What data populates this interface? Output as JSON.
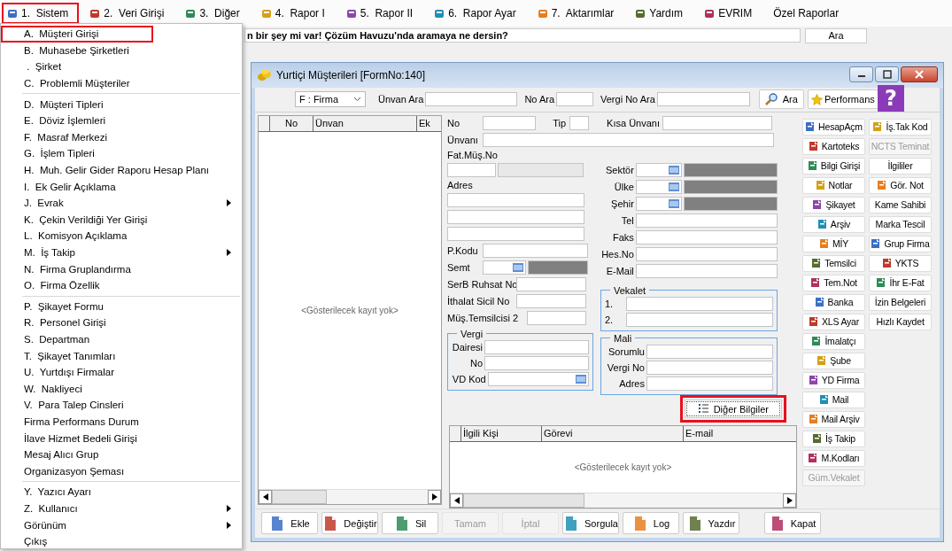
{
  "menu_bar": [
    {
      "label": "1.  Sistem",
      "icon": true,
      "highlighted": true
    },
    {
      "label": "2.  Veri Girişi",
      "icon": true,
      "highlighted": false
    },
    {
      "label": "3.  Diğer",
      "icon": true,
      "highlighted": false
    },
    {
      "label": "4.  Rapor I",
      "icon": true,
      "highlighted": false
    },
    {
      "label": "5.  Rapor II",
      "icon": true,
      "highlighted": false
    },
    {
      "label": "6.  Rapor Ayar",
      "icon": true,
      "highlighted": false
    },
    {
      "label": "7.  Aktarımlar",
      "icon": true,
      "highlighted": false
    },
    {
      "label": "Yardım",
      "icon": true,
      "highlighted": false
    },
    {
      "label": "EVRIM",
      "icon": true,
      "highlighted": false
    },
    {
      "label": "Özel Raporlar",
      "icon": false,
      "highlighted": false
    }
  ],
  "search_bar": {
    "value": "n bir şey mi var! Çözüm Havuzu'nda aramaya ne dersin?",
    "button": "Ara"
  },
  "dropdown": [
    {
      "kind": "item",
      "label": "A.  Müşteri Girişi",
      "highlighted": true,
      "submenu": false
    },
    {
      "kind": "item",
      "label": "B.  Muhasebe Şirketleri",
      "highlighted": false,
      "submenu": false
    },
    {
      "kind": "item",
      "label": " .  Şirket",
      "highlighted": false,
      "submenu": false
    },
    {
      "kind": "item",
      "label": "C.  Problemli Müşteriler",
      "highlighted": false,
      "submenu": false
    },
    {
      "kind": "separator"
    },
    {
      "kind": "item",
      "label": "D.  Müşteri Tipleri",
      "highlighted": false,
      "submenu": false
    },
    {
      "kind": "item",
      "label": "E.  Döviz İşlemleri",
      "highlighted": false,
      "submenu": false
    },
    {
      "kind": "item",
      "label": "F.  Masraf Merkezi",
      "highlighted": false,
      "submenu": false
    },
    {
      "kind": "item",
      "label": "G.  İşlem Tipleri",
      "highlighted": false,
      "submenu": false
    },
    {
      "kind": "item",
      "label": "H.  Muh. Gelir Gider Raporu Hesap Planı",
      "highlighted": false,
      "submenu": false
    },
    {
      "kind": "item",
      "label": "I.  Ek Gelir Açıklama",
      "highlighted": false,
      "submenu": false
    },
    {
      "kind": "item",
      "label": "J.  Evrak",
      "highlighted": false,
      "submenu": true
    },
    {
      "kind": "item",
      "label": "K.  Çekin Verildiği Yer Girişi",
      "highlighted": false,
      "submenu": false
    },
    {
      "kind": "item",
      "label": "L.  Komisyon Açıklama",
      "highlighted": false,
      "submenu": false
    },
    {
      "kind": "item",
      "label": "M.  İş Takip",
      "highlighted": false,
      "submenu": true
    },
    {
      "kind": "item",
      "label": "N.  Firma Gruplandırma",
      "highlighted": false,
      "submenu": false
    },
    {
      "kind": "item",
      "label": "O.  Firma Özellik",
      "highlighted": false,
      "submenu": false
    },
    {
      "kind": "separator"
    },
    {
      "kind": "item",
      "label": "P.  Şikayet Formu",
      "highlighted": false,
      "submenu": false
    },
    {
      "kind": "item",
      "label": "R.  Personel Girişi",
      "highlighted": false,
      "submenu": false
    },
    {
      "kind": "item",
      "label": "S.  Departman",
      "highlighted": false,
      "submenu": false
    },
    {
      "kind": "item",
      "label": "T.  Şikayet Tanımları",
      "highlighted": false,
      "submenu": false
    },
    {
      "kind": "item",
      "label": "U.  Yurtdışı Firmalar",
      "highlighted": false,
      "submenu": false
    },
    {
      "kind": "item",
      "label": "W.  Nakliyeci",
      "highlighted": false,
      "submenu": false
    },
    {
      "kind": "item",
      "label": "V.  Para Talep Cinsleri",
      "highlighted": false,
      "submenu": false
    },
    {
      "kind": "item",
      "label": "Firma Performans Durum",
      "highlighted": false,
      "submenu": false
    },
    {
      "kind": "item",
      "label": "İlave Hizmet Bedeli Girişi",
      "highlighted": false,
      "submenu": false
    },
    {
      "kind": "item",
      "label": "Mesaj Alıcı Grup",
      "highlighted": false,
      "submenu": false
    },
    {
      "kind": "item",
      "label": "Organizasyon Şeması",
      "highlighted": false,
      "submenu": false
    },
    {
      "kind": "separator"
    },
    {
      "kind": "item",
      "label": "Y.  Yazıcı Ayarı",
      "highlighted": false,
      "submenu": false
    },
    {
      "kind": "item",
      "label": "Z.  Kullanıcı",
      "highlighted": false,
      "submenu": true
    },
    {
      "kind": "item",
      "label": "Görünüm",
      "highlighted": false,
      "submenu": true
    },
    {
      "kind": "item",
      "label": "Çıkış",
      "highlighted": false,
      "submenu": false
    }
  ],
  "window": {
    "title": "Yurtiçi Müşterileri [FormNo:140]",
    "help_badge": "?"
  },
  "search_toolbar": {
    "type_combo": "F : Firma",
    "labels": [
      "Ünvan Ara",
      "No Ara",
      "Vergi No Ara"
    ],
    "buttons": [
      "Ara",
      "Performans"
    ]
  },
  "list_grid": {
    "columns": [
      "No",
      "Ünvan",
      "Ek"
    ],
    "empty": "<Gösterilecek kayıt yok>"
  },
  "form": {
    "no": "No",
    "tip": "Tip",
    "short_title": "Kısa Ünvanı",
    "title": "Ünvanı",
    "invoice_customer_no": "Fat.Müş.No",
    "address": "Adres",
    "postal_code": "P.Kodu",
    "district": "Semt",
    "license_no": "SerB Ruhsat No",
    "import_reg_no": "İthalat Sicil No",
    "representative_2": "Müş.Temsilcisi 2",
    "right_fields": [
      {
        "label": "Sektör",
        "kind": "lookup"
      },
      {
        "label": "Ülke",
        "kind": "lookup"
      },
      {
        "label": "Şehir",
        "kind": "lookup"
      },
      {
        "label": "Tel",
        "kind": "text"
      },
      {
        "label": "Faks",
        "kind": "text"
      },
      {
        "label": "Hes.No",
        "kind": "text"
      },
      {
        "label": "E-Mail",
        "kind": "text"
      }
    ],
    "tax_group": {
      "title": "Vergi",
      "fields": [
        {
          "label": "Dairesi",
          "kind": "text"
        },
        {
          "label": "No",
          "kind": "text"
        },
        {
          "label": "VD Kod",
          "kind": "lookup"
        }
      ]
    },
    "proxy_group": {
      "title": "Vekalet",
      "fields": [
        "1.",
        "2."
      ]
    },
    "finance_group": {
      "title": "Mali",
      "fields": [
        "Sorumlu",
        "Vergi No",
        "Adres"
      ]
    },
    "more_button": {
      "label": "Diğer Bilgiler",
      "highlighted": true
    }
  },
  "contacts_grid": {
    "columns": [
      "İlgili Kişi",
      "Görevi",
      "E-mail"
    ],
    "empty": "<Gösterilecek kayıt yok>"
  },
  "side_buttons": {
    "column_1": [
      {
        "label": "HesapAçm",
        "icon": true,
        "disabled": false
      },
      {
        "label": "Kartoteks",
        "icon": true,
        "disabled": false
      },
      {
        "label": "Bilgi Girişi",
        "icon": true,
        "disabled": false
      },
      {
        "label": "Notlar",
        "icon": true,
        "disabled": false
      },
      {
        "label": "Şikayet",
        "icon": true,
        "disabled": false
      },
      {
        "label": "Arşiv",
        "icon": true,
        "disabled": false
      },
      {
        "label": "MİY",
        "icon": true,
        "disabled": false
      },
      {
        "label": "Temsilci",
        "icon": true,
        "disabled": false
      },
      {
        "label": "Tem.Not",
        "icon": true,
        "disabled": false
      },
      {
        "label": "Banka",
        "icon": true,
        "disabled": false
      },
      {
        "label": "XLS Ayar",
        "icon": true,
        "disabled": false
      },
      {
        "label": "İmalatçı",
        "icon": true,
        "disabled": false
      },
      {
        "label": "Şube",
        "icon": true,
        "disabled": false
      },
      {
        "label": "YD Firma",
        "icon": true,
        "disabled": false
      },
      {
        "label": "Mail",
        "icon": true,
        "disabled": false
      },
      {
        "label": "Mail Arşiv",
        "icon": true,
        "disabled": false
      },
      {
        "label": "İş Takip",
        "icon": true,
        "disabled": false
      },
      {
        "label": "M.Kodları",
        "icon": true,
        "disabled": false
      },
      {
        "label": "Güm.Vekalet",
        "icon": false,
        "disabled": true
      }
    ],
    "column_2": [
      {
        "label": "İş.Tak Kod",
        "icon": true,
        "disabled": false
      },
      {
        "label": "NCTS Teminat",
        "icon": false,
        "disabled": true
      },
      {
        "label": "İlgililer",
        "icon": false,
        "disabled": false
      },
      {
        "label": "Gör. Not",
        "icon": true,
        "disabled": false
      },
      {
        "label": "Kame Sahibi",
        "icon": false,
        "disabled": false
      },
      {
        "label": "Marka Tescil",
        "icon": false,
        "disabled": false
      },
      {
        "label": "Grup Firma",
        "icon": true,
        "disabled": false
      },
      {
        "label": "YKTS",
        "icon": true,
        "disabled": false
      },
      {
        "label": "İhr E-Fat",
        "icon": true,
        "disabled": false
      },
      {
        "label": "İzin Belgeleri",
        "icon": false,
        "disabled": false
      },
      {
        "label": "Hızlı Kaydet",
        "icon": false,
        "disabled": false
      }
    ]
  },
  "bottom_buttons": [
    {
      "label": "Ekle",
      "icon": true,
      "disabled": false
    },
    {
      "label": "Değiştir",
      "icon": true,
      "disabled": false
    },
    {
      "label": "Sil",
      "icon": true,
      "disabled": false
    },
    {
      "label": "Tamam",
      "icon": false,
      "disabled": true
    },
    {
      "label": "İptal",
      "icon": false,
      "disabled": true
    },
    {
      "label": "Sorgula",
      "icon": true,
      "disabled": false
    },
    {
      "label": "Log",
      "icon": true,
      "disabled": false
    },
    {
      "label": "Yazdır",
      "icon": true,
      "disabled": false
    },
    {
      "label": "Kapat",
      "icon": true,
      "disabled": false
    }
  ]
}
